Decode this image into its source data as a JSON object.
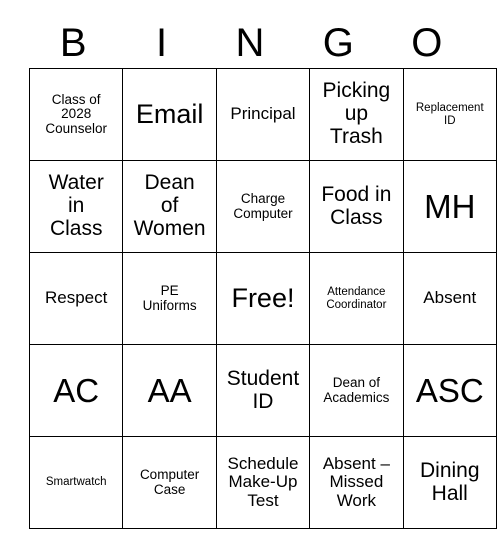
{
  "card": {
    "title": "BINGO",
    "header_letters": [
      "B",
      "I",
      "N",
      "G",
      "O"
    ],
    "free_space": "Free!",
    "rows": [
      [
        {
          "text": "Class of\n2028\nCounselor",
          "size": "sz-sm"
        },
        {
          "text": "Email",
          "size": "sz-xl"
        },
        {
          "text": "Principal",
          "size": "sz-md"
        },
        {
          "text": "Picking\nup\nTrash",
          "size": "sz-lg"
        },
        {
          "text": "Replacement\nID",
          "size": "sz-xs"
        }
      ],
      [
        {
          "text": "Water\nin\nClass",
          "size": "sz-lg"
        },
        {
          "text": "Dean\nof\nWomen",
          "size": "sz-lg"
        },
        {
          "text": "Charge\nComputer",
          "size": "sz-sm"
        },
        {
          "text": "Food in\nClass",
          "size": "sz-lg"
        },
        {
          "text": "MH",
          "size": "sz-xxl"
        }
      ],
      [
        {
          "text": "Respect",
          "size": "sz-md"
        },
        {
          "text": "PE\nUniforms",
          "size": "sz-sm"
        },
        {
          "text": "Free!",
          "size": "sz-xl"
        },
        {
          "text": "Attendance\nCoordinator",
          "size": "sz-xs"
        },
        {
          "text": "Absent",
          "size": "sz-md"
        }
      ],
      [
        {
          "text": "AC",
          "size": "sz-xxl"
        },
        {
          "text": "AA",
          "size": "sz-xxl"
        },
        {
          "text": "Student\nID",
          "size": "sz-lg"
        },
        {
          "text": "Dean of\nAcademics",
          "size": "sz-sm"
        },
        {
          "text": "ASC",
          "size": "sz-xxl"
        }
      ],
      [
        {
          "text": "Smartwatch",
          "size": "sz-xs"
        },
        {
          "text": "Computer\nCase",
          "size": "sz-sm"
        },
        {
          "text": "Schedule\nMake-Up\nTest",
          "size": "sz-md"
        },
        {
          "text": "Absent –\nMissed\nWork",
          "size": "sz-md"
        },
        {
          "text": "Dining\nHall",
          "size": "sz-lg"
        }
      ]
    ]
  },
  "colors": {
    "background": "#ffffff",
    "text": "#000000",
    "border": "#000000"
  }
}
